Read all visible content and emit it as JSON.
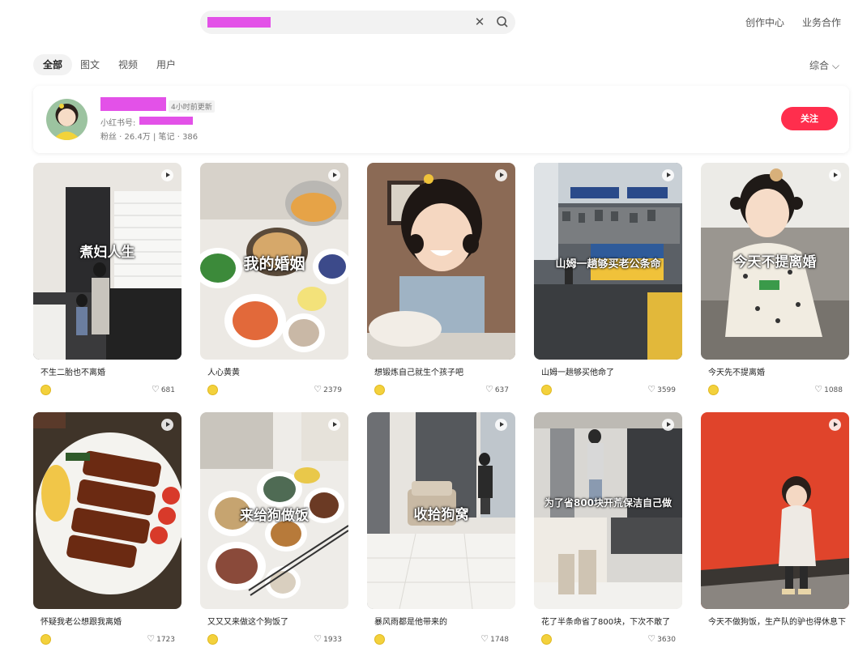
{
  "header": {
    "links": [
      "创作中心",
      "业务合作"
    ]
  },
  "tabs": [
    "全部",
    "图文",
    "视频",
    "用户"
  ],
  "sort_label": "综合",
  "user_card": {
    "updated": "4小时前更新",
    "id_label": "小红书号:",
    "stats": "粉丝 · 26.4万  |  笔记 · 386",
    "follow_label": "关注"
  },
  "notes": [
    {
      "title": "不生二胎也不离婚",
      "likes": "681",
      "overlay": "煮妇人生",
      "caption": ""
    },
    {
      "title": "人心黄黄",
      "likes": "2379",
      "overlay": "我的婚姻",
      "caption": ""
    },
    {
      "title": "想锻炼自己就生个孩子吧",
      "likes": "637",
      "overlay": "",
      "caption": ""
    },
    {
      "title": "山姆一趟够买他命了",
      "likes": "3599",
      "overlay": "山姆一趟够买老公条命",
      "caption": ""
    },
    {
      "title": "今天先不提离婚",
      "likes": "1088",
      "overlay": "今天不提离婚",
      "caption": ""
    },
    {
      "title": "怀疑我老公想跟我离婚",
      "likes": "1723",
      "overlay": "",
      "caption": ""
    },
    {
      "title": "又又又来做这个狗饭了",
      "likes": "1933",
      "overlay": "来给狗做饭",
      "caption": ""
    },
    {
      "title": "暴风雨都是他带来的",
      "likes": "1748",
      "overlay": "收拾狗窝",
      "caption": ""
    },
    {
      "title": "花了半条命省了800块，下次不敢了",
      "likes": "3630",
      "overlay": "为了省800块开荒保洁自己做",
      "caption": ""
    },
    {
      "title": "今天不做狗饭，生产队的驴也得休息下",
      "likes": "",
      "overlay": "",
      "caption": ""
    }
  ],
  "colors": {
    "accent": "#ff2e4d",
    "redaction": "#e351e8"
  }
}
